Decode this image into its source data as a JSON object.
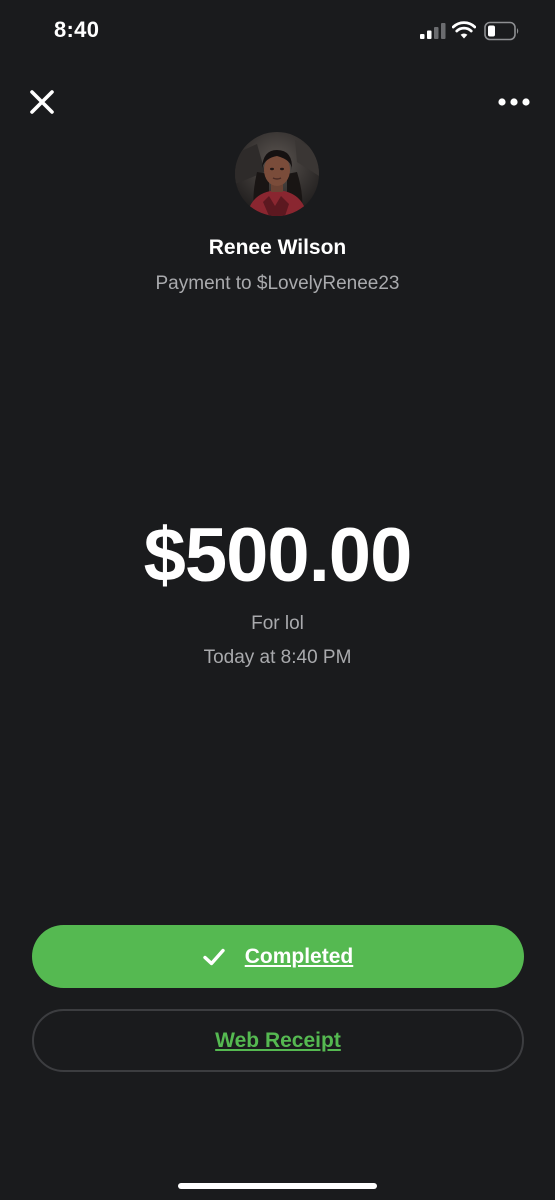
{
  "status_bar": {
    "time": "8:40",
    "icons": [
      "signal-icon",
      "wifi-icon",
      "battery-icon"
    ]
  },
  "header": {
    "close_icon": "close-icon",
    "more_icon": "more-icon"
  },
  "recipient": {
    "name": "Renee Wilson",
    "subtitle": "Payment to $LovelyRenee23"
  },
  "payment": {
    "amount": "$500.00",
    "note": "For lol",
    "timestamp": "Today at 8:40 PM"
  },
  "actions": {
    "completed_label": "Completed",
    "completed_icon": "check-icon",
    "web_receipt_label": "Web Receipt"
  },
  "colors": {
    "background": "#1a1b1d",
    "accent_green": "#55b951",
    "secondary_text": "#a9aaad"
  }
}
